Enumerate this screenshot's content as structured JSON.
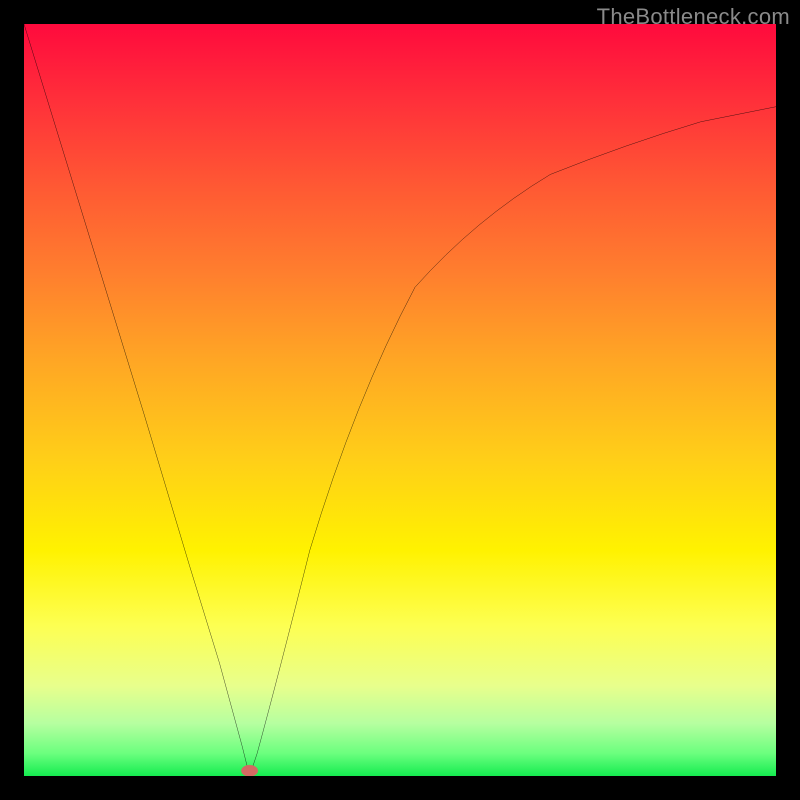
{
  "source_label": "TheBottleneck.com",
  "chart_data": {
    "type": "line",
    "title": "",
    "xlabel": "",
    "ylabel": "",
    "xlim": [
      0,
      100
    ],
    "ylim": [
      0,
      100
    ],
    "x": [
      0,
      8,
      16,
      22,
      26,
      29,
      30,
      31,
      34,
      38,
      44,
      52,
      60,
      70,
      80,
      90,
      100
    ],
    "y": [
      100,
      74,
      48,
      28,
      15,
      4,
      0,
      3,
      14,
      30,
      50,
      65,
      74,
      80,
      84,
      87,
      89
    ],
    "marker": {
      "x": 30,
      "y": 0
    },
    "gradient_stops": [
      {
        "pos": 0,
        "color": "#ff0a3d"
      },
      {
        "pos": 50,
        "color": "#ffcf18"
      },
      {
        "pos": 100,
        "color": "#15ec50"
      }
    ]
  }
}
